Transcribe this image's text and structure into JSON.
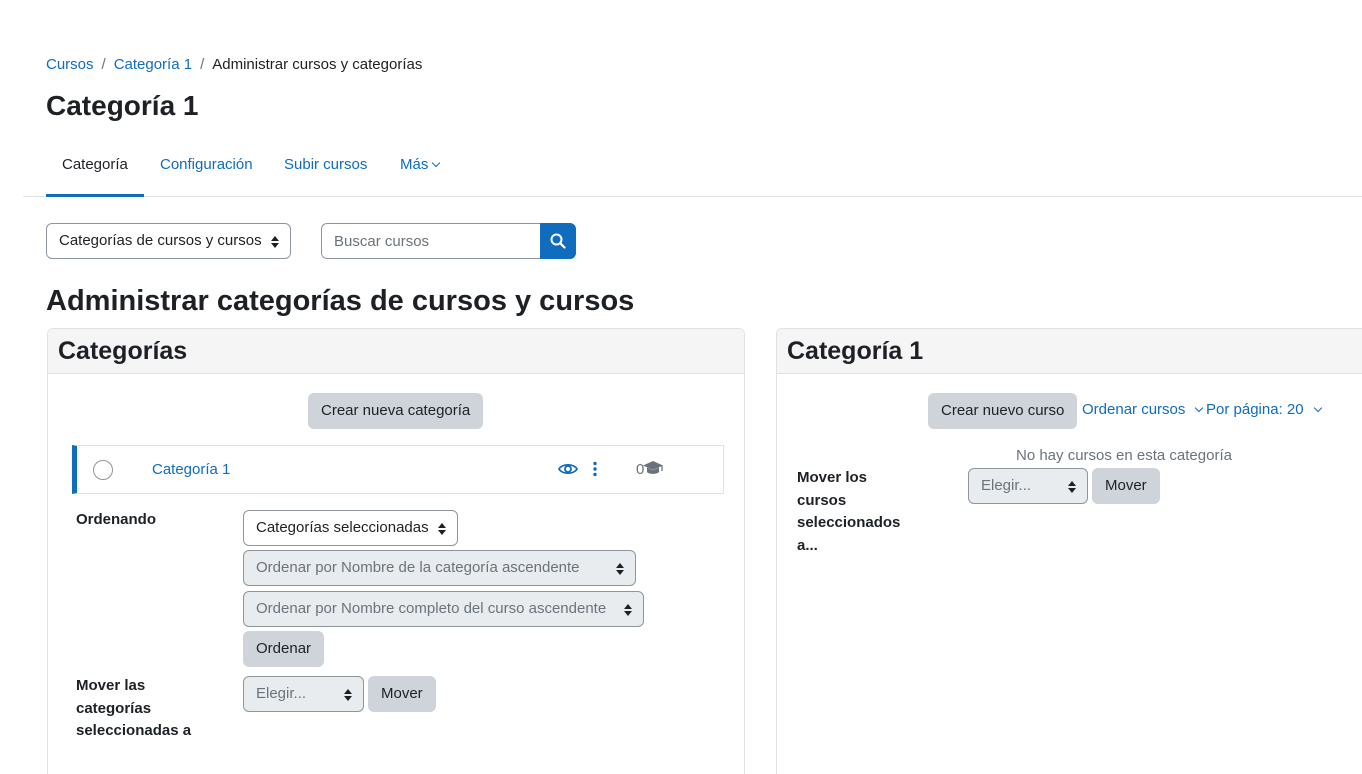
{
  "breadcrumb": {
    "items": [
      "Cursos",
      "Categoría 1"
    ],
    "current": "Administrar cursos y categorías",
    "separator": "/"
  },
  "page_title": "Categoría 1",
  "tabs": {
    "categoria": "Categoría",
    "configuracion": "Configuración",
    "subir": "Subir cursos",
    "mas": "Más"
  },
  "view_select": "Categorías de cursos y cursos",
  "search": {
    "placeholder": "Buscar cursos"
  },
  "heading": "Administrar categorías de cursos y cursos",
  "categories_panel": {
    "title": "Categorías",
    "create_button": "Crear nueva categoría",
    "row": {
      "name": "Categoría 1",
      "count": "0"
    },
    "sorting_label": "Ordenando",
    "sort_scope_select": "Categorías seleccionadas",
    "sort_categories_select": "Ordenar por Nombre de la categoría ascendente",
    "sort_courses_select": "Ordenar por Nombre completo del curso ascendente",
    "sort_button": "Ordenar",
    "move_label": "Mover las categorías seleccionadas a",
    "move_select": "Elegir...",
    "move_button": "Mover"
  },
  "courses_panel": {
    "title": "Categoría 1",
    "create_button": "Crear nuevo curso",
    "sort_link": "Ordenar cursos",
    "per_page_link": "Por página: 20",
    "empty_text": "No hay cursos en esta categoría",
    "move_label": "Mover los cursos seleccionados a...",
    "move_select": "Elegir...",
    "move_button": "Mover"
  },
  "colors": {
    "accent": "#0f6cbf",
    "button_bg": "#ced4da",
    "text": "#1d2125"
  },
  "icons": [
    "search-icon",
    "eye-icon",
    "kebab-menu-icon",
    "graduation-cap-icon",
    "chevron-down-icon",
    "select-arrows-icon"
  ]
}
